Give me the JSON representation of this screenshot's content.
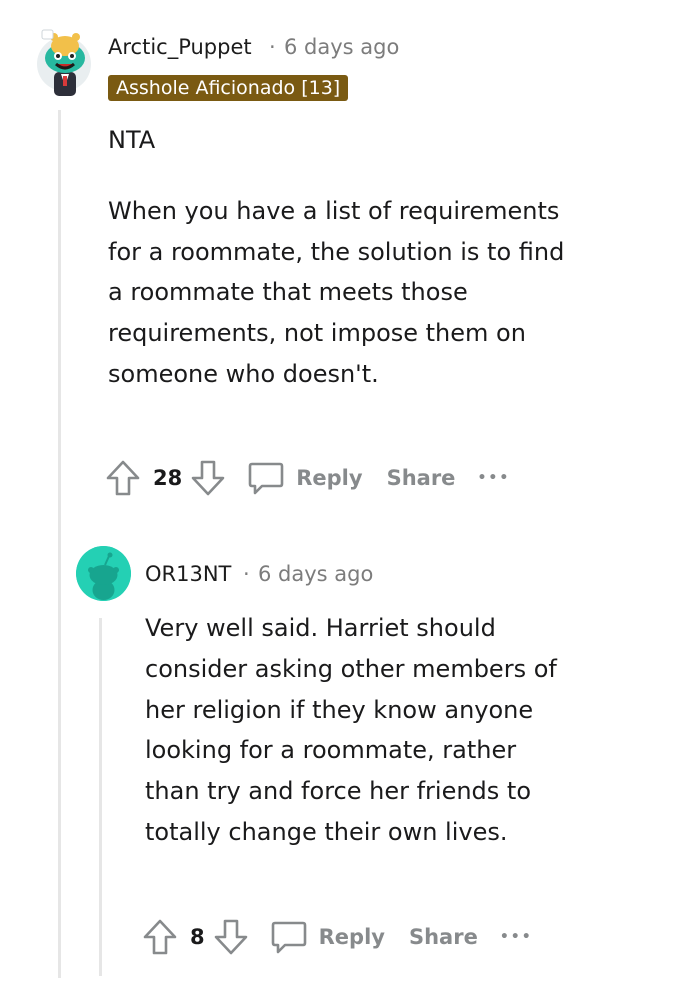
{
  "comments": [
    {
      "username": "Arctic_Puppet",
      "separator": "·",
      "timestamp": "6 days ago",
      "flair": "Asshole Aficionado [13]",
      "paragraphs": [
        "NTA",
        "When you have a list of requirements for a roommate, the solution is to find a roommate that meets those requirements, not impose them on someone who doesn't."
      ],
      "score": "28",
      "reply_label": "Reply",
      "share_label": "Share",
      "more_label": "•••"
    },
    {
      "username": "OR13NT",
      "separator": "·",
      "timestamp": "6 days ago",
      "paragraphs": [
        "Very well said. Harriet should consider asking other members of her religion if they know anyone looking for a roommate, rather than try and force her friends to totally change their own lives."
      ],
      "score": "8",
      "reply_label": "Reply",
      "share_label": "Share",
      "more_label": "•••"
    }
  ],
  "colors": {
    "flair_bg": "#7a5a12",
    "avatar2_bg": "#24d0b4",
    "muted_text": "#878a8c",
    "thread_line": "#e6e6e6"
  }
}
